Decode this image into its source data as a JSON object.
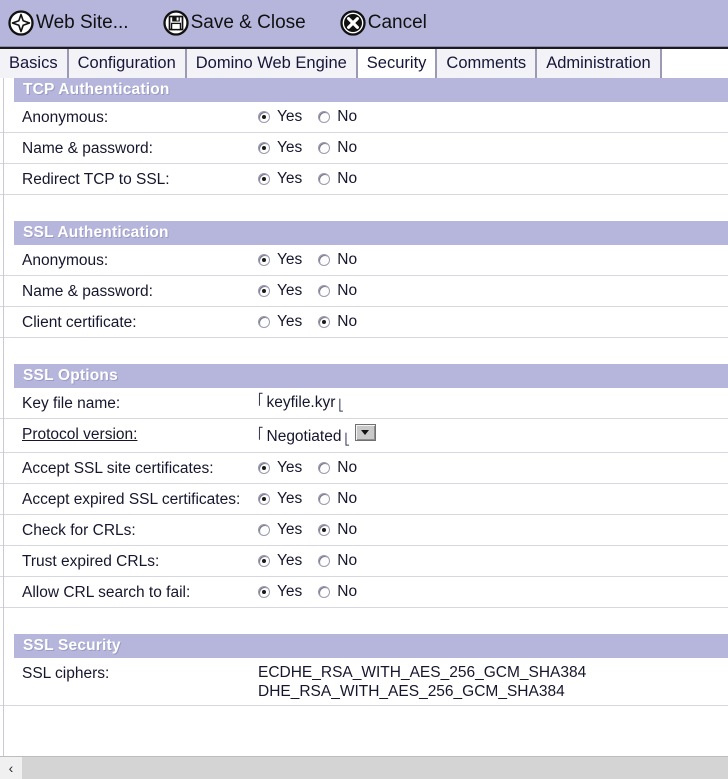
{
  "toolbar": {
    "buttons": [
      {
        "label": "Web Site...",
        "icon": "web-site-icon"
      },
      {
        "label": "Save & Close",
        "icon": "save-disk-icon"
      },
      {
        "label": "Cancel",
        "icon": "cancel-x-icon"
      }
    ]
  },
  "tabs": [
    {
      "label": "Basics",
      "active": false
    },
    {
      "label": "Configuration",
      "active": false
    },
    {
      "label": "Domino Web Engine",
      "active": false
    },
    {
      "label": "Security",
      "active": true
    },
    {
      "label": "Comments",
      "active": false
    },
    {
      "label": "Administration",
      "active": false
    }
  ],
  "options": {
    "yes": "Yes",
    "no": "No"
  },
  "sections": [
    {
      "title": "TCP Authentication",
      "rows": [
        {
          "label": "Anonymous:",
          "type": "radio",
          "value": "Yes"
        },
        {
          "label": "Name & password:",
          "type": "radio",
          "value": "Yes"
        },
        {
          "label": "Redirect TCP to SSL:",
          "type": "radio",
          "value": "Yes"
        }
      ]
    },
    {
      "title": "SSL Authentication",
      "rows": [
        {
          "label": "Anonymous:",
          "type": "radio",
          "value": "Yes"
        },
        {
          "label": "Name & password:",
          "type": "radio",
          "value": "Yes"
        },
        {
          "label": "Client certificate:",
          "type": "radio",
          "value": "No"
        }
      ]
    },
    {
      "title": "SSL Options",
      "rows": [
        {
          "label": "Key file name:",
          "type": "text",
          "value": "keyfile.kyr"
        },
        {
          "label": "Protocol version:",
          "type": "select",
          "value": "Negotiated",
          "underline": true
        },
        {
          "label": "Accept SSL site certificates:",
          "type": "radio",
          "value": "Yes"
        },
        {
          "label": "Accept expired SSL certificates:",
          "type": "radio",
          "value": "Yes"
        },
        {
          "label": "Check for CRLs:",
          "type": "radio",
          "value": "No"
        },
        {
          "label": "Trust expired CRLs:",
          "type": "radio",
          "value": "Yes"
        },
        {
          "label": "Allow CRL search to fail:",
          "type": "radio",
          "value": "Yes"
        }
      ]
    },
    {
      "title": "SSL Security",
      "rows": [
        {
          "label": "SSL ciphers:",
          "type": "multiline",
          "lines": [
            "ECDHE_RSA_WITH_AES_256_GCM_SHA384",
            "DHE_RSA_WITH_AES_256_GCM_SHA384"
          ]
        }
      ]
    }
  ],
  "scrollbar": {
    "left_arrow": "‹"
  },
  "colors": {
    "accent": "#b6b6dc",
    "header_text": "#ffffff",
    "text": "#16162e",
    "separator": "#d7d7e2"
  }
}
